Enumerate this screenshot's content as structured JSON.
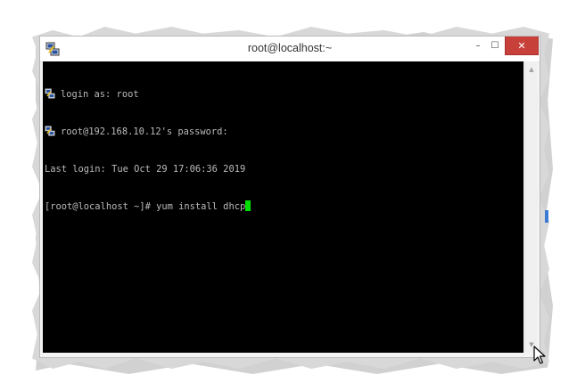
{
  "window": {
    "title": "root@localhost:~",
    "app_icon": "putty-icon",
    "controls": {
      "minimize_glyph": "–",
      "maximize_glyph": "☐",
      "close_glyph": "✕"
    }
  },
  "terminal": {
    "lines": [
      {
        "icon": "putty-icon",
        "text": "login as: root"
      },
      {
        "icon": "putty-icon",
        "text": "root@192.168.10.12's password:"
      },
      {
        "icon": "",
        "text": "Last login: Tue Oct 29 17:06:36 2019"
      },
      {
        "icon": "",
        "text": "[root@localhost ~]# yum install dhcp"
      }
    ],
    "cursor_color": "#00e000",
    "background_color": "#000000",
    "text_color": "#bbbbbb"
  },
  "scrollbar": {
    "up_glyph": "▲",
    "down_glyph": "▼"
  },
  "colors": {
    "close_button": "#c8403a",
    "accent_sliver": "#3b7bd4"
  }
}
